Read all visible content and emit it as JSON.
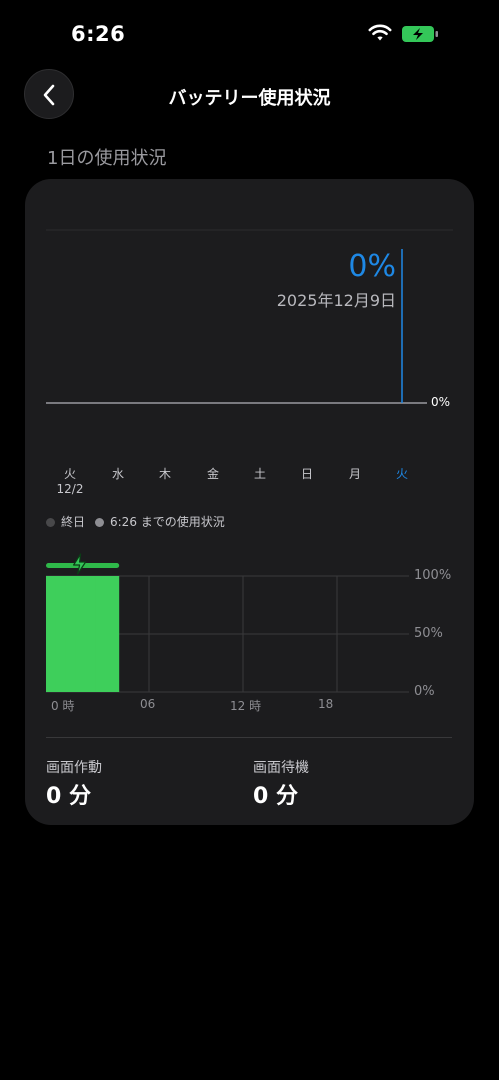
{
  "status": {
    "time": "6:26"
  },
  "header": {
    "title": "バッテリー使用状況"
  },
  "section": {
    "title": "1日の使用状況"
  },
  "level_chart": {
    "current_pct": "0%",
    "date": "2025年12月9日",
    "axis_label": "0%"
  },
  "days": [
    {
      "label": "火",
      "sub": "12/2",
      "active": false
    },
    {
      "label": "水",
      "active": false
    },
    {
      "label": "木",
      "active": false
    },
    {
      "label": "金",
      "active": false
    },
    {
      "label": "土",
      "active": false
    },
    {
      "label": "日",
      "active": false
    },
    {
      "label": "月",
      "active": false
    },
    {
      "label": "火",
      "active": true
    }
  ],
  "legend": [
    {
      "label": "終日",
      "color": "#48484a"
    },
    {
      "label": "6:26 までの使用状況",
      "color": "#8e8e93"
    }
  ],
  "chart_data": {
    "type": "bar",
    "title": "",
    "x_ticks": [
      "0 時",
      "06",
      "12 時",
      "18"
    ],
    "y_ticks": [
      "100%",
      "50%",
      "0%"
    ],
    "ylim": [
      0,
      100
    ],
    "x_range_hours": [
      0,
      24
    ],
    "charging_bar": {
      "from_hour": 0,
      "to_hour": 6.5
    },
    "series": [
      {
        "x_hours": [
          0,
          0.75,
          1.5,
          2.25,
          3.0,
          3.75,
          4.5
        ],
        "values": [
          100,
          100,
          100,
          100,
          100,
          100,
          100
        ]
      }
    ],
    "bar_color": "#3ecf5b",
    "charging_color": "#2fb94a"
  },
  "stats": [
    {
      "label": "画面作動",
      "value": "0 分"
    },
    {
      "label": "画面待機",
      "value": "0 分"
    }
  ]
}
